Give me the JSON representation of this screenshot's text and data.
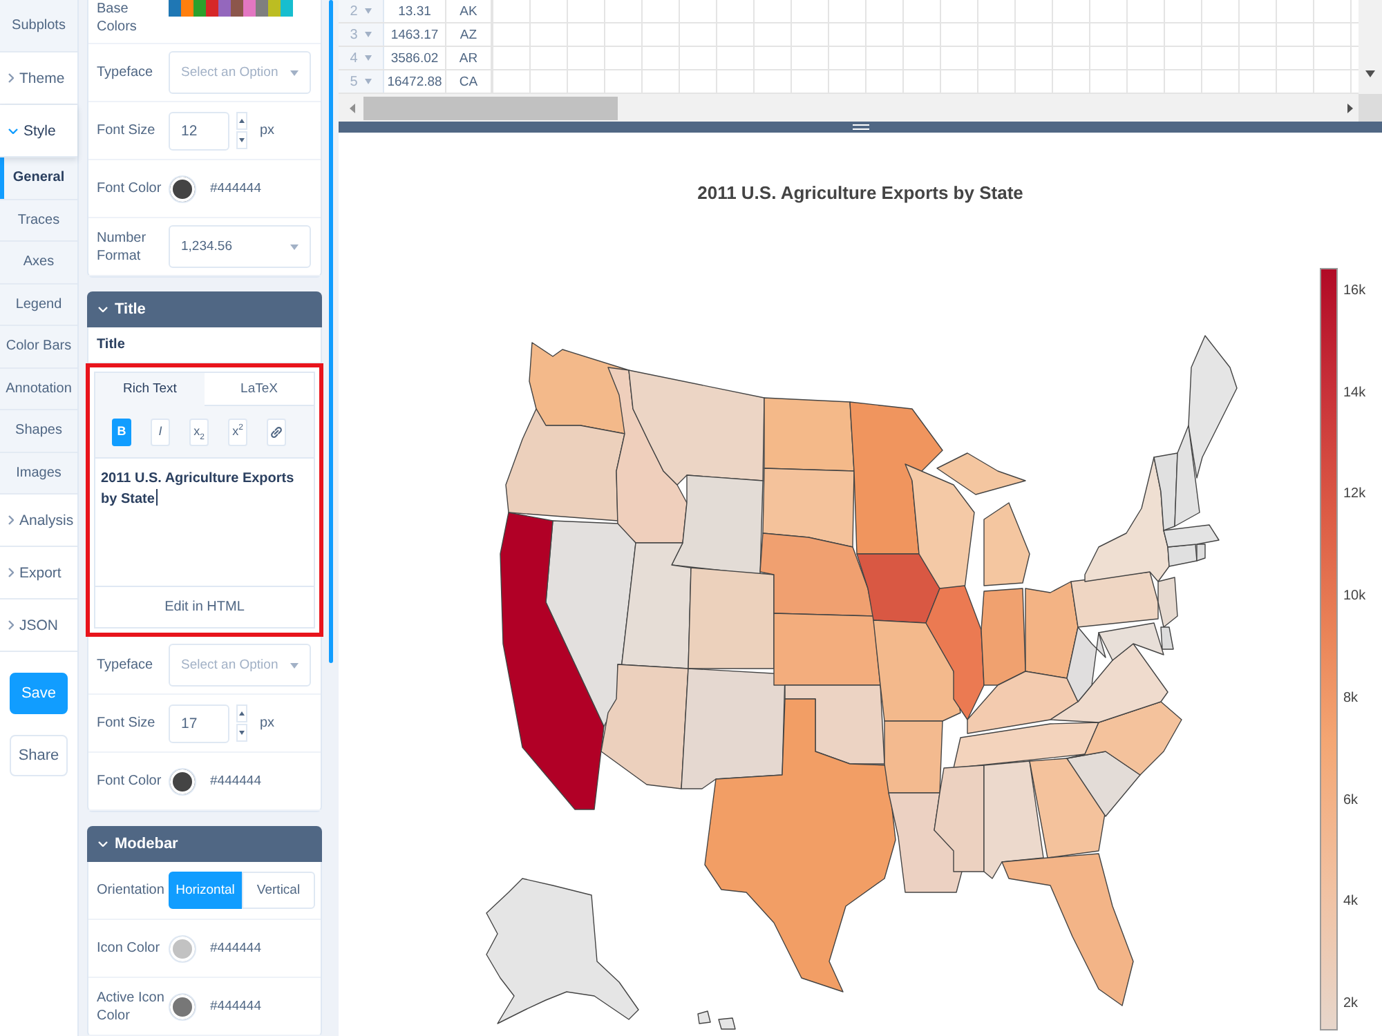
{
  "nav": {
    "items": [
      {
        "kind": "subitem",
        "label": "Subplots",
        "selected": false
      },
      {
        "kind": "group",
        "label": "Theme",
        "expanded": false
      },
      {
        "kind": "group",
        "label": "Style",
        "expanded": true,
        "children": [
          {
            "label": "General",
            "selected": true
          },
          {
            "label": "Traces",
            "selected": false
          },
          {
            "label": "Axes",
            "selected": false
          },
          {
            "label": "Legend",
            "selected": false
          },
          {
            "label": "Color Bars",
            "selected": false
          },
          {
            "label": "Annotation",
            "selected": false
          },
          {
            "label": "Shapes",
            "selected": false
          },
          {
            "label": "Images",
            "selected": false
          }
        ]
      },
      {
        "kind": "group",
        "label": "Analysis",
        "expanded": false
      },
      {
        "kind": "group",
        "label": "Export",
        "expanded": false
      },
      {
        "kind": "group",
        "label": "JSON",
        "expanded": false
      }
    ],
    "buttons": [
      {
        "kind": "primary",
        "label": "Save"
      },
      {
        "kind": "secondary",
        "label": "Share"
      }
    ]
  },
  "panel": {
    "sections": [
      {
        "rows": [
          {
            "kind": "swatches",
            "label": "Base Colors",
            "colors": [
              {
                "color": "#1f77b4"
              },
              {
                "color": "#ff7f0e"
              },
              {
                "color": "#2ca02c"
              },
              {
                "color": "#d62728"
              },
              {
                "color": "#9467bd"
              },
              {
                "color": "#8c564b"
              },
              {
                "color": "#e377c2"
              },
              {
                "color": "#7f7f7f"
              },
              {
                "color": "#bcbd22"
              },
              {
                "color": "#17becf"
              }
            ]
          },
          {
            "kind": "select",
            "label": "Typeface",
            "placeholder": "Select an Option"
          },
          {
            "kind": "number",
            "label": "Font Size",
            "value": "12",
            "unit": "px"
          },
          {
            "kind": "color",
            "label": "Font Color",
            "color": "#444444",
            "value": "#444444"
          },
          {
            "kind": "select",
            "label": "Number Format",
            "value": "1,234.56"
          }
        ]
      },
      {
        "title": "Title",
        "expanded": true,
        "rows": [
          {
            "kind": "heading",
            "label": "Title"
          },
          {
            "kind": "richtext",
            "highlighted": true,
            "tabs": [
              {
                "label": "Rich Text",
                "selected": true
              },
              {
                "label": "LaTeX",
                "selected": false
              }
            ],
            "tools": [
              {
                "kind": "bold",
                "label": "B",
                "selected": true
              },
              {
                "kind": "italic",
                "label": "I",
                "selected": false
              },
              {
                "kind": "subscript",
                "label": "x$_{2}$",
                "selected": false
              },
              {
                "kind": "superscript",
                "label": "x$^{2}$",
                "selected": false
              },
              {
                "kind": "link",
                "selected": false
              }
            ],
            "value": "2011 U.S. Agriculture Exports by State",
            "focused": true,
            "footer": "Edit in HTML"
          },
          {
            "kind": "select",
            "label": "Typeface",
            "placeholder": "Select an Option"
          },
          {
            "kind": "number",
            "label": "Font Size",
            "value": "17",
            "unit": "px"
          },
          {
            "kind": "color",
            "label": "Font Color",
            "color": "#444444",
            "value": "#444444"
          }
        ]
      },
      {
        "title": "Modebar",
        "expanded": true,
        "rows": [
          {
            "kind": "toggle",
            "label": "Orientation",
            "options": [
              {
                "label": "Horizontal",
                "selected": true
              },
              {
                "label": "Vertical",
                "selected": false
              }
            ]
          },
          {
            "kind": "color",
            "label": "Icon Color",
            "color": "#c2c2c2",
            "value": "#444444"
          },
          {
            "kind": "color",
            "label": "Active Icon Color",
            "color": "#777777",
            "value": "#444444"
          }
        ]
      }
    ]
  },
  "grid": {
    "rows": [
      {
        "number": "2",
        "cells": [
          "13.31",
          "AK"
        ]
      },
      {
        "number": "3",
        "cells": [
          "1463.17",
          "AZ"
        ]
      },
      {
        "number": "4",
        "cells": [
          "3586.02",
          "AR"
        ]
      },
      {
        "number": "5",
        "cells": [
          "16472.88",
          "CA"
        ]
      }
    ]
  },
  "plot": {
    "title": "2011 U.S. Agriculture Exports by State",
    "colorbar": {
      "ticks": [
        "16k",
        "14k",
        "12k",
        "10k",
        "8k",
        "6k",
        "4k",
        "2k"
      ]
    }
  }
}
